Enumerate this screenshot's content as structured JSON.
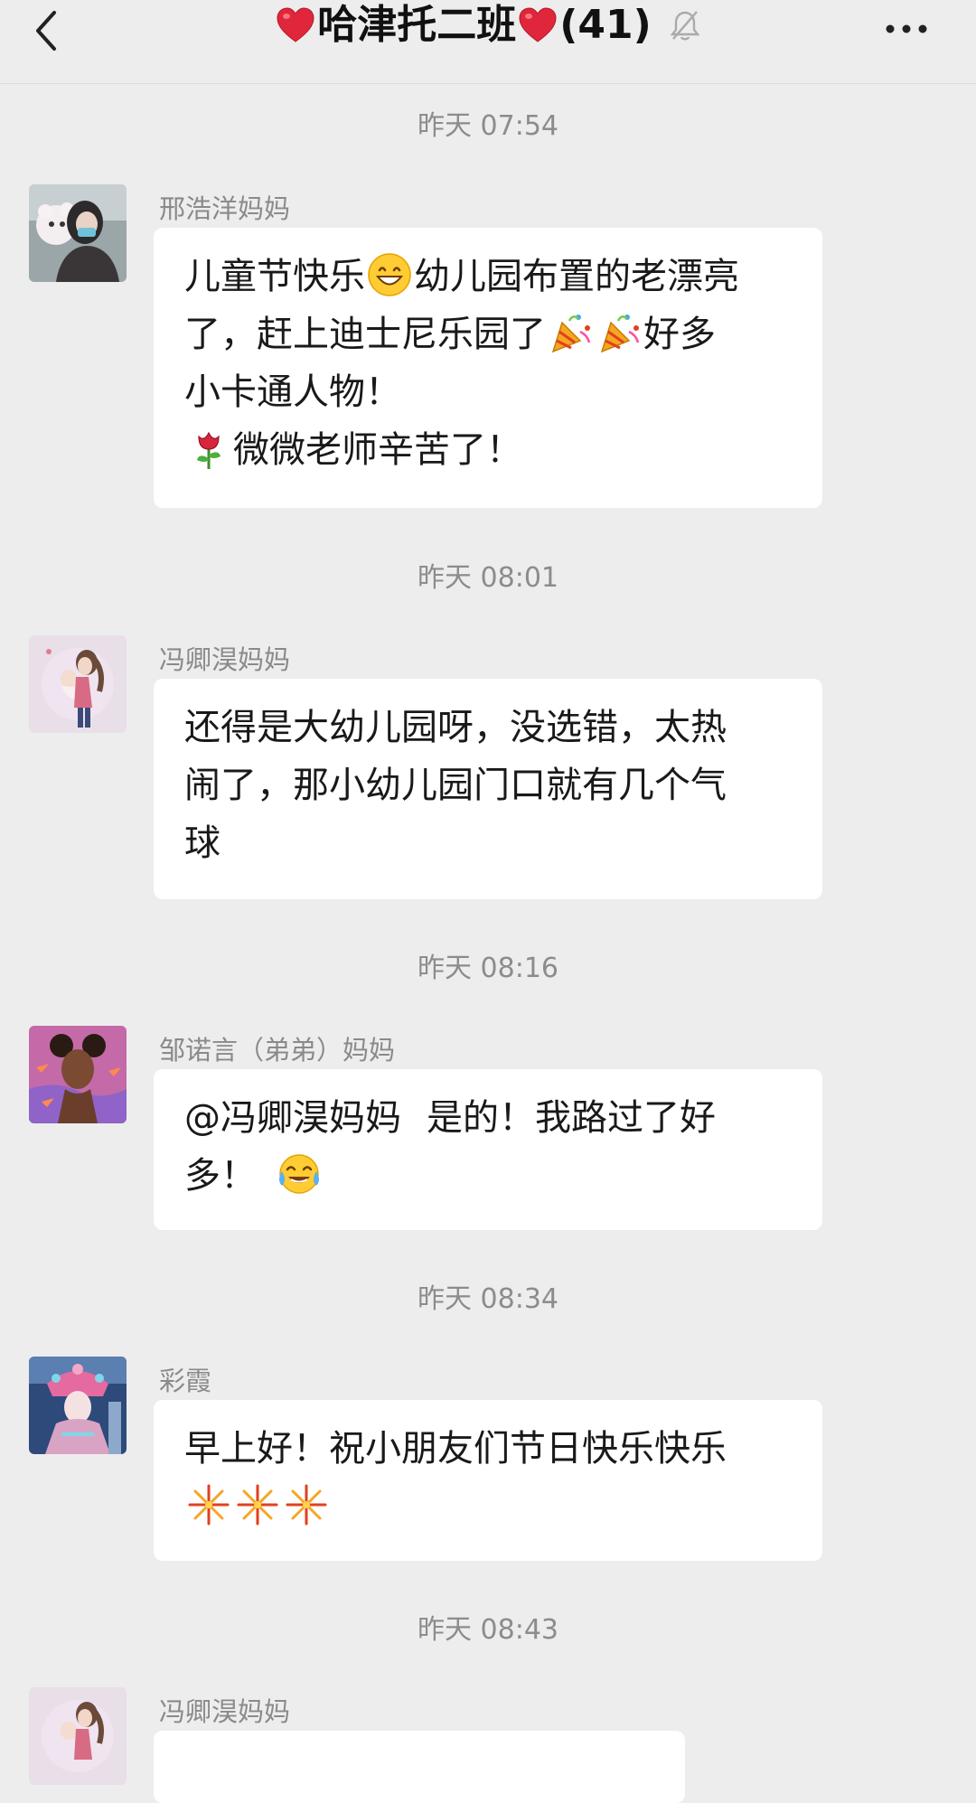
{
  "header": {
    "title": "哈津托二班",
    "member_count": "(41)",
    "icons": [
      "back-arrow-icon",
      "heart-icon",
      "mute-bell-icon",
      "more-dots-icon"
    ]
  },
  "timestamps": [
    "昨天 07:54",
    "昨天 08:01",
    "昨天 08:16",
    "昨天 08:34",
    "昨天 08:43"
  ],
  "messages": [
    {
      "sender": "邢浩洋妈妈",
      "avatar": "woman-with-plush-toy-avatar",
      "lines": [
        "儿童节快乐",
        "幼儿园布置的老漂亮",
        "了，赶上迪士尼乐园了",
        "好多",
        "小卡通人物！",
        "微微老师辛苦了！"
      ]
    },
    {
      "sender": "冯卿淏妈妈",
      "avatar": "mother-holding-baby-avatar",
      "lines": [
        "还得是大幼儿园呀，没选错，太热",
        "闹了，那小幼儿园门口就有几个气",
        "球"
      ]
    },
    {
      "sender": "邹诺言（弟弟）妈妈",
      "avatar": "illustrated-girl-avatar",
      "lines": [
        "@冯卿淏妈妈",
        "是的！我路过了好",
        "多！"
      ]
    },
    {
      "sender": "彩霞",
      "avatar": "opera-costume-avatar",
      "lines": [
        "早上好！祝小朋友们节日快乐快乐"
      ]
    },
    {
      "sender": "冯卿淏妈妈",
      "avatar": "mother-holding-baby-avatar",
      "lines": []
    }
  ],
  "colors": {
    "background": "#ededed",
    "bubble": "#ffffff",
    "timestamp_text": "#8c8c8c",
    "sender_text": "#8a8a8a"
  }
}
